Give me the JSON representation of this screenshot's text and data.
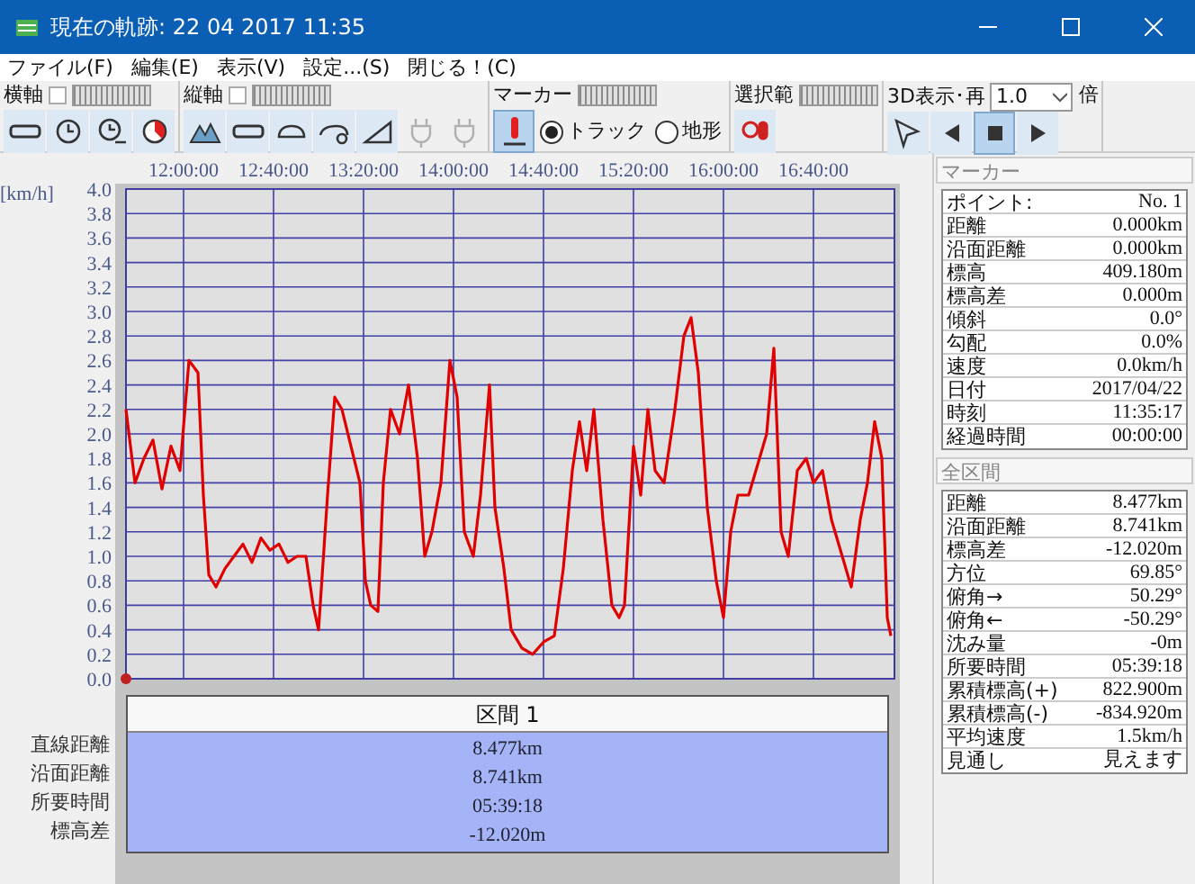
{
  "window": {
    "title": "現在の軌跡: 22 04 2017 11:35"
  },
  "menu": [
    "ファイル(F)",
    "編集(E)",
    "表示(V)",
    "設定...(S)",
    "閉じる！(C)"
  ],
  "toolbar": [
    {
      "label": "横軸",
      "tools": [
        {
          "kind": "button",
          "selected": false
        },
        {
          "kind": "button",
          "selected": false
        },
        {
          "kind": "button",
          "selected": false
        },
        {
          "kind": "button",
          "selected": false
        }
      ]
    },
    {
      "label": "縦軸",
      "tools": [
        {
          "kind": "button",
          "selected": false
        },
        {
          "kind": "button",
          "selected": false
        },
        {
          "kind": "button",
          "selected": false
        },
        {
          "kind": "button",
          "selected": false
        },
        {
          "kind": "button",
          "selected": false
        },
        {
          "kind": "button",
          "selected": false,
          "disabled": true
        },
        {
          "kind": "button",
          "selected": false,
          "disabled": true
        }
      ]
    },
    {
      "label": "マーカー",
      "tools": [
        {
          "kind": "button",
          "selected": true
        },
        {
          "kind": "radio",
          "label": "トラック",
          "selected": true
        },
        {
          "kind": "radio",
          "label": "地形",
          "selected": false
        }
      ]
    },
    {
      "label": "選択範",
      "tools": [
        {
          "kind": "button",
          "selected": false
        }
      ]
    },
    {
      "label": "3D表示･再",
      "select": "1.0",
      "suffix": "倍",
      "tools": [
        {
          "kind": "button",
          "selected": false
        },
        {
          "kind": "button",
          "selected": false
        },
        {
          "kind": "button",
          "selected": true
        },
        {
          "kind": "button",
          "selected": false
        }
      ]
    }
  ],
  "chart": {
    "unit": "[km/h]",
    "chart_data": {
      "type": "line",
      "grid": true,
      "xlim": [
        694.4,
        1036
      ],
      "ylim": [
        0,
        4
      ],
      "xticks": [
        {
          "value": 720,
          "label": "12:00:00"
        },
        {
          "value": 760,
          "label": "12:40:00"
        },
        {
          "value": 800,
          "label": "13:20:00"
        },
        {
          "value": 840,
          "label": "14:00:00"
        },
        {
          "value": 880,
          "label": "14:40:00"
        },
        {
          "value": 920,
          "label": "15:20:00"
        },
        {
          "value": 960,
          "label": "16:00:00"
        },
        {
          "value": 1000,
          "label": "16:40:00"
        }
      ],
      "yticks": [
        {
          "value": 0,
          "label": "0.0"
        },
        {
          "value": 0.2,
          "label": "0.2"
        },
        {
          "value": 0.4,
          "label": "0.4"
        },
        {
          "value": 0.6,
          "label": "0.6"
        },
        {
          "value": 0.8,
          "label": "0.8"
        },
        {
          "value": 1,
          "label": "1.0"
        },
        {
          "value": 1.2,
          "label": "1.2"
        },
        {
          "value": 1.4,
          "label": "1.4"
        },
        {
          "value": 1.6,
          "label": "1.6"
        },
        {
          "value": 1.8,
          "label": "1.8"
        },
        {
          "value": 2,
          "label": "2.0"
        },
        {
          "value": 2.2,
          "label": "2.2"
        },
        {
          "value": 2.4,
          "label": "2.4"
        },
        {
          "value": 2.6,
          "label": "2.6"
        },
        {
          "value": 2.8,
          "label": "2.8"
        },
        {
          "value": 3,
          "label": "3.0"
        },
        {
          "value": 3.2,
          "label": "3.2"
        },
        {
          "value": 3.4,
          "label": "3.4"
        },
        {
          "value": 3.6,
          "label": "3.6"
        },
        {
          "value": 3.8,
          "label": "3.8"
        },
        {
          "value": 4,
          "label": "4.0"
        }
      ],
      "x": [
        694.4,
        698.4,
        702.4,
        706.4,
        710.4,
        714.4,
        718.4,
        722.4,
        726.4,
        728.8,
        731.2,
        734.4,
        738.4,
        742.4,
        746.4,
        750.4,
        754.4,
        758.4,
        762.4,
        766.4,
        770.4,
        774.4,
        777.6,
        780,
        784,
        787.2,
        790.4,
        794.4,
        798.4,
        800.8,
        803.2,
        806.4,
        808.8,
        812,
        816,
        820,
        824,
        827.2,
        830.4,
        834.4,
        838.4,
        841.6,
        844.8,
        848.8,
        852,
        856,
        858.4,
        862.4,
        865.6,
        870.4,
        875.2,
        880,
        884.8,
        888.8,
        892.8,
        896,
        899.2,
        902.4,
        906.4,
        910.4,
        913.6,
        916,
        920,
        923.2,
        926.4,
        929.6,
        933.6,
        938.4,
        942.4,
        945.6,
        948.8,
        952.8,
        956.8,
        960,
        963.2,
        966.4,
        971.2,
        976,
        979.2,
        982.4,
        985.6,
        988.8,
        992.8,
        996.8,
        1000,
        1004,
        1008,
        1012.8,
        1016.8,
        1020.8,
        1024,
        1027.2,
        1030.4,
        1032.8,
        1034.4
      ],
      "series": [
        {
          "color": "#e00000",
          "values": [
            2.2,
            1.6,
            1.8,
            1.95,
            1.55,
            1.9,
            1.7,
            2.6,
            2.5,
            1.5,
            0.85,
            0.75,
            0.9,
            1.0,
            1.1,
            0.95,
            1.15,
            1.05,
            1.1,
            0.95,
            1.0,
            1.0,
            0.6,
            0.4,
            1.5,
            2.3,
            2.2,
            1.9,
            1.6,
            0.8,
            0.6,
            0.55,
            1.6,
            2.2,
            2.0,
            2.4,
            1.8,
            1.0,
            1.2,
            1.6,
            2.6,
            2.3,
            1.2,
            1.0,
            1.5,
            2.4,
            1.4,
            0.9,
            0.4,
            0.25,
            0.2,
            0.3,
            0.35,
            0.9,
            1.7,
            2.1,
            1.7,
            2.2,
            1.3,
            0.6,
            0.5,
            0.6,
            1.9,
            1.5,
            2.2,
            1.7,
            1.6,
            2.2,
            2.8,
            2.95,
            2.5,
            1.4,
            0.8,
            0.5,
            1.2,
            1.5,
            1.5,
            1.8,
            2.0,
            2.7,
            1.2,
            1.0,
            1.7,
            1.8,
            1.6,
            1.7,
            1.3,
            1.0,
            0.75,
            1.3,
            1.6,
            2.1,
            1.8,
            0.5,
            0.35
          ]
        }
      ]
    }
  },
  "segment_table": {
    "header": "区間 1",
    "rows": [
      {
        "label": "直線距離",
        "value": "8.477km"
      },
      {
        "label": "沿面距離",
        "value": "8.741km"
      },
      {
        "label": "所要時間",
        "value": "05:39:18"
      },
      {
        "label": "標高差",
        "value": "-12.020m"
      }
    ]
  },
  "marker_panel": {
    "title": "マーカー",
    "rows": [
      {
        "label": "ポイント:",
        "value": "No. 1"
      },
      {
        "label": "距離",
        "value": "0.000km"
      },
      {
        "label": "沿面距離",
        "value": "0.000km"
      },
      {
        "label": "標高",
        "value": "409.180m"
      },
      {
        "label": "標高差",
        "value": "0.000m"
      },
      {
        "label": "傾斜",
        "value": "0.0°"
      },
      {
        "label": "勾配",
        "value": "0.0%"
      },
      {
        "label": "速度",
        "value": "0.0km/h"
      },
      {
        "label": "日付",
        "value": "2017/04/22"
      },
      {
        "label": "時刻",
        "value": "11:35:17"
      },
      {
        "label": "経過時間",
        "value": "00:00:00"
      }
    ]
  },
  "total_panel": {
    "title": "全区間",
    "rows": [
      {
        "label": "距離",
        "value": "8.477km"
      },
      {
        "label": "沿面距離",
        "value": "8.741km"
      },
      {
        "label": "標高差",
        "value": "-12.020m"
      },
      {
        "label": "方位",
        "value": "69.85°"
      },
      {
        "label": "俯角→",
        "value": "50.29°"
      },
      {
        "label": "俯角←",
        "value": "-50.29°"
      },
      {
        "label": "沈み量",
        "value": "-0m"
      },
      {
        "label": "所要時間",
        "value": "05:39:18"
      },
      {
        "label": "累積標高(+)",
        "value": "822.900m"
      },
      {
        "label": "累積標高(-)",
        "value": "-834.920m"
      },
      {
        "label": "平均速度",
        "value": "1.5km/h"
      },
      {
        "label": "見通し",
        "value": "見えます"
      }
    ]
  }
}
